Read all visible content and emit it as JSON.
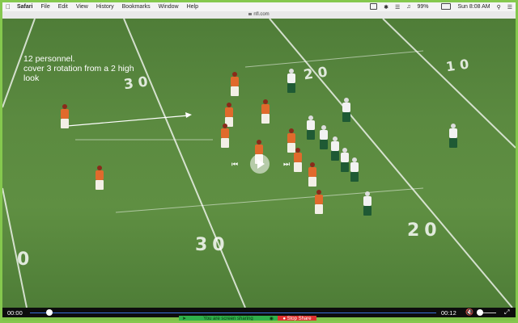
{
  "menubar": {
    "apple": "",
    "app": "Safari",
    "items": [
      "File",
      "Edit",
      "View",
      "History",
      "Bookmarks",
      "Window",
      "Help"
    ],
    "battery": "99%",
    "clock": "Sun 8:08 AM"
  },
  "browser": {
    "url": "nfl.com"
  },
  "annotation": {
    "line1": "12 personnel.",
    "line2": "cover 3 rotation from a 2 high",
    "line3": "look"
  },
  "field": {
    "yard_top_left": "30",
    "yard_top_mid": "20",
    "yard_top_right": "10",
    "yard_bottom_left": "0",
    "yard_bottom_mid": "30",
    "yard_bottom_right": "20"
  },
  "video_overlay": {
    "prev_icon": "skip-back-icon",
    "play_icon": "play-icon",
    "next_icon": "skip-forward-icon"
  },
  "controls": {
    "current_time": "00:00",
    "duration": "00:12",
    "progress": 0.05,
    "volume_icon": "mute-icon",
    "fullscreen_icon": "fullscreen-icon"
  },
  "sharebar": {
    "text": "You are screen sharing",
    "stop_label": "Stop Share",
    "share_color": "#2fb04a",
    "stop_color": "#e0322f"
  }
}
